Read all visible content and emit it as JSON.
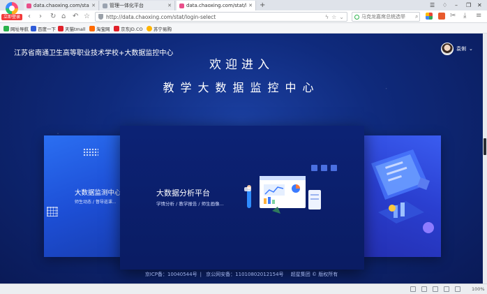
{
  "browser": {
    "badge": "立即登录",
    "tabs": [
      {
        "title": "data.chaoxing.com/stat/login",
        "favicon_color": "#e94f8a",
        "active": false
      },
      {
        "title": "管理一体化平台",
        "favicon_color": "#9aa3b0",
        "active": false
      },
      {
        "title": "data.chaoxing.com/stat/login",
        "favicon_color": "#e94f8a",
        "active": true
      }
    ],
    "new_tab": "+",
    "address_url": "http://data.chaoxing.com/stat/login-select",
    "search_placeholder": "马克龙嘉席总统选举",
    "bookmarks": [
      {
        "label": "网址导航",
        "color": "#2bb24c"
      },
      {
        "label": "百度一下",
        "color": "#2e5bd8"
      },
      {
        "label": "天猫tmall",
        "color": "#e0202a"
      },
      {
        "label": "淘宝网",
        "color": "#ff6a00"
      },
      {
        "label": "京东JD.CO",
        "color": "#e0202a"
      },
      {
        "label": "苏宁易购",
        "color": "#ffb400"
      }
    ],
    "zoom": "100%"
  },
  "page": {
    "school_title": "江苏省南通卫生高等职业技术学校+大数据监控中心",
    "user_name": "袁俐",
    "welcome": "欢迎进入",
    "subtitle": "教学大数据监控中心",
    "cards": {
      "left": {
        "title": "大数据监测中心",
        "subtitle": "师生动态 / 督导巡课..."
      },
      "main": {
        "title": "大数据分析平台",
        "subtitle": "学情分析 / 教学报告 / 师生画像..."
      },
      "right": {}
    },
    "footer": {
      "icp": "京ICP备：10040544号",
      "police": "京公网安备：11010802012154号",
      "copyright": "超星集团 © 版权所有"
    }
  },
  "colors": {
    "page_bg": "#0f2a7c",
    "card_left": "#2b6ff2",
    "card_main": "#0c2275",
    "card_right": "#3a5cf0"
  }
}
